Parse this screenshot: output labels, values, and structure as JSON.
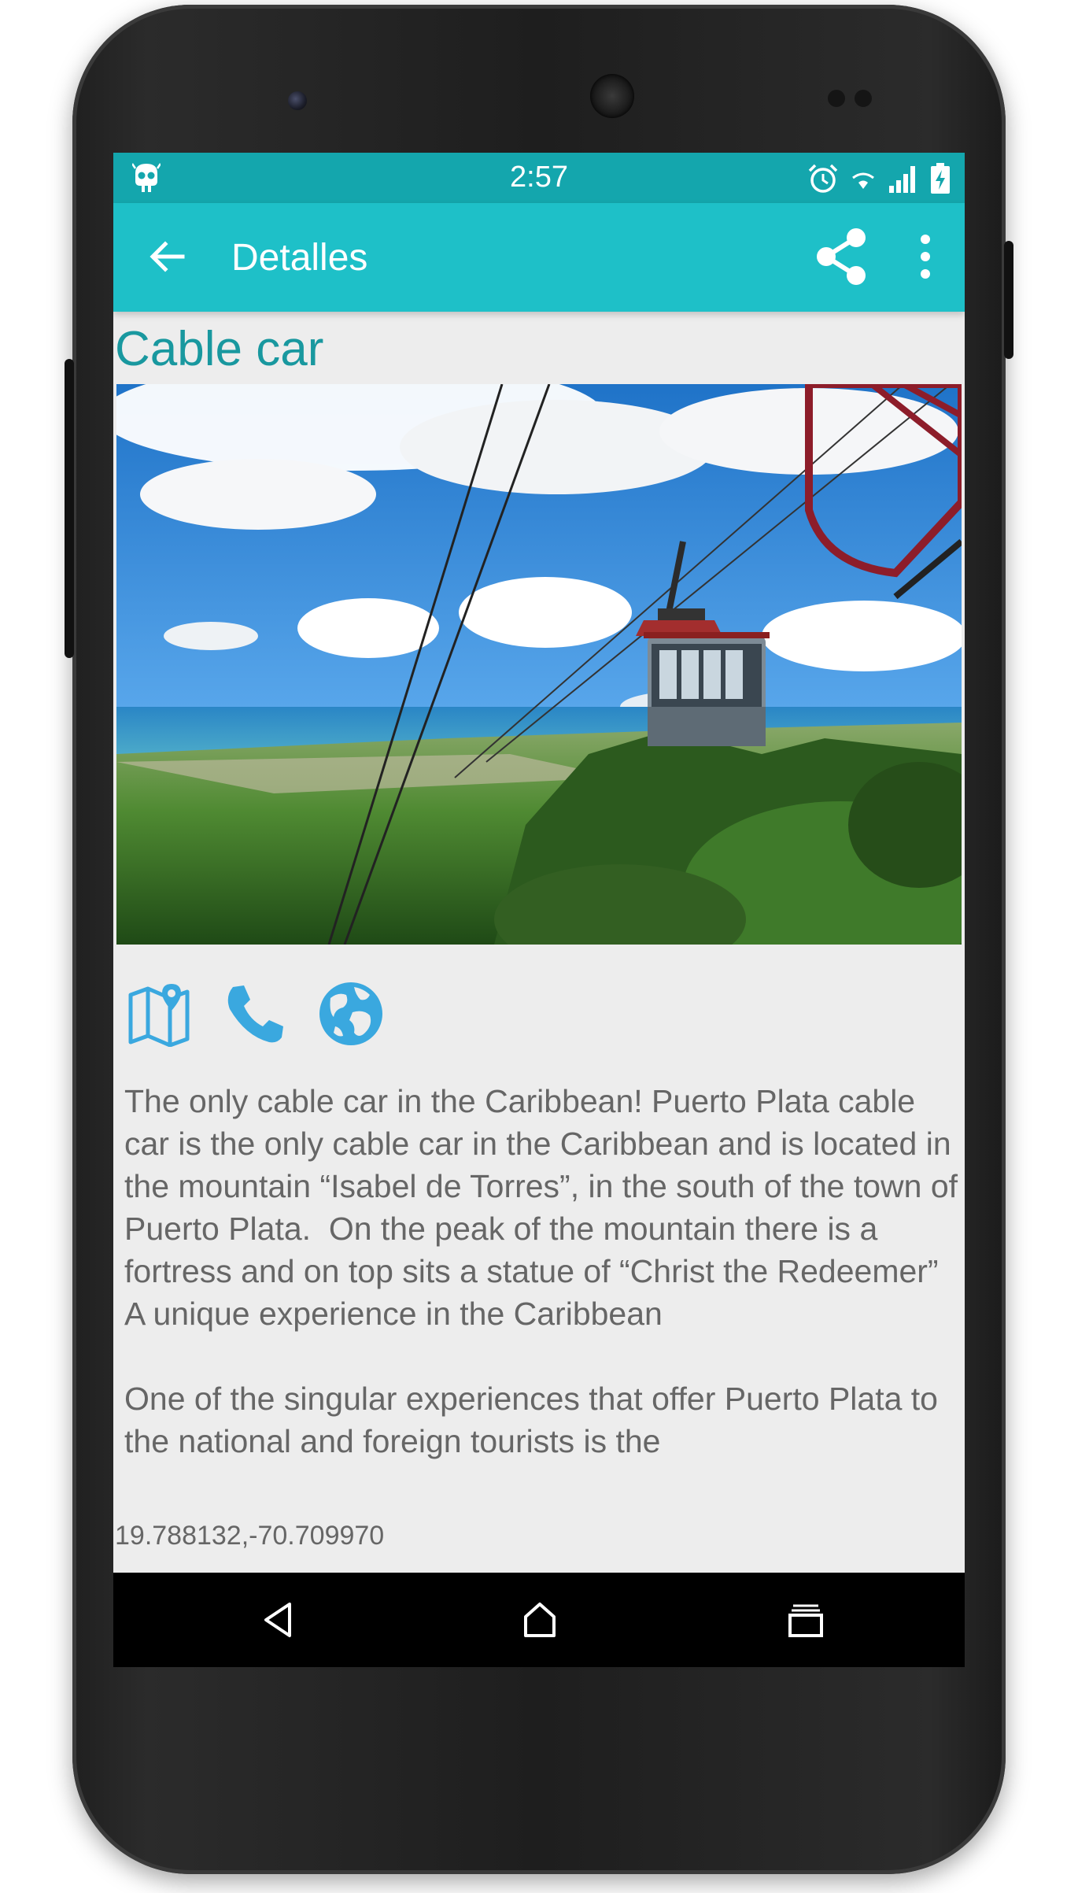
{
  "status_bar": {
    "time": "2:57",
    "icons": [
      "android-mascot-icon",
      "alarm-icon",
      "wifi-icon",
      "signal-icon",
      "battery-charging-icon"
    ]
  },
  "toolbar": {
    "title": "Detalles",
    "back_icon": "arrow-left-icon",
    "share_icon": "share-icon",
    "more_icon": "more-vert-icon"
  },
  "detail": {
    "title": "Cable car",
    "image_alt": "Cable car over Puerto Plata",
    "actions": [
      {
        "name": "map-icon"
      },
      {
        "name": "phone-icon"
      },
      {
        "name": "globe-icon"
      }
    ],
    "description": "The only cable car in the Caribbean! Puerto Plata cable car is the only cable car in the Caribbean and is located in the mountain “Isabel de Torres”, in the south of the town of Puerto Plata.  On the peak of the mountain there is a fortress and on top sits a statue of “Christ the Redeemer”\nA unique experience in the Caribbean\n\nOne of the singular experiences that offer Puerto Plata to the national and foreign tourists is the",
    "coordinates": "19.788132,-70.709970"
  },
  "nav_bar": {
    "icons": [
      "back-triangle-icon",
      "home-icon",
      "recents-icon"
    ]
  },
  "colors": {
    "status_bar": "#14a6ad",
    "toolbar": "#1ec0c8",
    "title_accent": "#19989f",
    "icon_blue": "#3aa8df",
    "text_gray": "#666666",
    "screen_bg": "#ededed"
  }
}
